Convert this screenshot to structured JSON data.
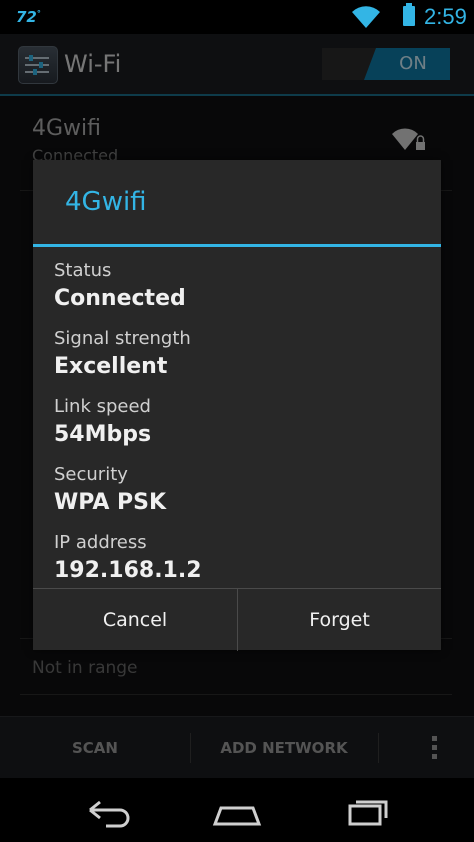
{
  "status_bar": {
    "temperature": "72",
    "degree": "°",
    "time": "2:59"
  },
  "action_bar": {
    "title": "Wi-Fi",
    "toggle_label": "ON"
  },
  "network_list": {
    "first": {
      "name": "4Gwifi",
      "status": "Connected"
    },
    "second_status": "Not in range"
  },
  "bottom_bar": {
    "scan_label": "SCAN",
    "add_network_label": "ADD NETWORK"
  },
  "dialog": {
    "title": "4Gwifi",
    "rows": [
      {
        "label": "Status",
        "value": "Connected"
      },
      {
        "label": "Signal strength",
        "value": "Excellent"
      },
      {
        "label": "Link speed",
        "value": "54Mbps"
      },
      {
        "label": "Security",
        "value": "WPA PSK"
      },
      {
        "label": "IP address",
        "value": "192.168.1.2"
      }
    ],
    "cancel_label": "Cancel",
    "forget_label": "Forget"
  },
  "colors": {
    "accent": "#33b5e5",
    "toggle_on": "#0e77a3"
  },
  "icons": [
    "wifi-signal-icon",
    "battery-icon",
    "settings-app-icon",
    "wifi-lock-icon",
    "overflow-menu-icon",
    "back-icon",
    "home-icon",
    "recents-icon"
  ]
}
